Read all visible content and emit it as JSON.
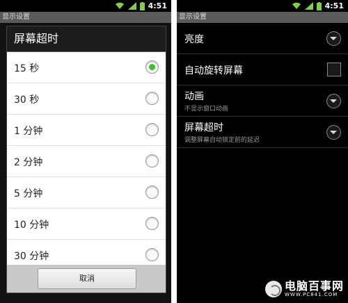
{
  "status": {
    "time": "4:51"
  },
  "left": {
    "window_title": "显示设置",
    "dialog": {
      "title": "屏幕超时",
      "options": [
        {
          "label": "15 秒",
          "selected": true
        },
        {
          "label": "30 秒",
          "selected": false
        },
        {
          "label": "1 分钟",
          "selected": false
        },
        {
          "label": "2 分钟",
          "selected": false
        },
        {
          "label": "5 分钟",
          "selected": false
        },
        {
          "label": "10 分钟",
          "selected": false
        },
        {
          "label": "30 分钟",
          "selected": false
        }
      ],
      "cancel_label": "取消"
    }
  },
  "right": {
    "window_title": "显示设置",
    "settings": [
      {
        "title": "亮度",
        "subtitle": "",
        "control": "chevron-down-icon"
      },
      {
        "title": "自动旋转屏幕",
        "subtitle": "",
        "control": "checkbox",
        "checked": false
      },
      {
        "title": "动画",
        "subtitle": "不显示窗口动画",
        "control": "chevron-down-icon"
      },
      {
        "title": "屏幕超时",
        "subtitle": "调整屏幕自动锁定前的延迟",
        "control": "chevron-down-icon"
      }
    ]
  },
  "watermark": {
    "brand": "电脑百事网",
    "url": "WWW.PC841.COM"
  },
  "colors": {
    "radio_selected": "#3fc12e",
    "titlebar_bg": "#5a5a5a",
    "dialog_header_bg": "#1c1c1c"
  }
}
